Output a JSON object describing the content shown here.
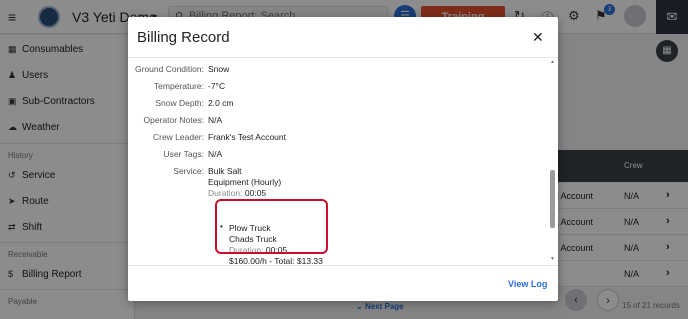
{
  "topbar": {
    "app_title": "V3 Yeti Demo",
    "search_placeholder": "Billing Report; Search",
    "training_label": "Training",
    "notification_count": "3"
  },
  "sidebar": {
    "items": [
      {
        "label": "Consumables",
        "icon": "box-icon"
      },
      {
        "label": "Users",
        "icon": "users-icon"
      },
      {
        "label": "Sub-Contractors",
        "icon": "contractor-icon"
      },
      {
        "label": "Weather",
        "icon": "cloud-icon"
      }
    ],
    "section_history": "History",
    "history_items": [
      {
        "label": "Service",
        "icon": "history-icon"
      },
      {
        "label": "Route",
        "icon": "route-icon"
      },
      {
        "label": "Shift",
        "icon": "shift-icon"
      }
    ],
    "section_receivable": "Receivable",
    "receivable_items": [
      {
        "label": "Billing Report",
        "icon": "dollar-icon"
      }
    ],
    "section_payable": "Payable"
  },
  "background_table": {
    "crew_header": "Crew",
    "rows": [
      {
        "c1": "t Account",
        "c2": "N/A"
      },
      {
        "c1": "t Account",
        "c2": "N/A"
      },
      {
        "c1": "t Account",
        "c2": "N/A"
      },
      {
        "c1": "t",
        "c2": "N/A"
      }
    ],
    "next_page_label": "Next Page",
    "records_count": "15 of 21 records"
  },
  "modal": {
    "title": "Billing Record",
    "fields": [
      {
        "label": "Ground Condition:",
        "value": "Snow"
      },
      {
        "label": "Temperature:",
        "value": "-7°C"
      },
      {
        "label": "Snow Depth:",
        "value": "2.0 cm"
      },
      {
        "label": "Operator Notes:",
        "value": "N/A"
      },
      {
        "label": "Crew Leader:",
        "value": "Frank's Test Account"
      },
      {
        "label": "User Tags:",
        "value": "N/A"
      },
      {
        "label": "Service:",
        "value": "Bulk Salt"
      }
    ],
    "service": {
      "equipment": "Equipment (Hourly)",
      "duration_label": "Duration:",
      "duration_value": "00:05"
    },
    "equipment_item": {
      "name": "Plow Truck",
      "truck": "Chads Truck",
      "duration_label": "Duration:",
      "duration_value": "00:05",
      "rate_total": "$160.00/h - Total: $13.33"
    },
    "view_log_label": "View Log"
  }
}
